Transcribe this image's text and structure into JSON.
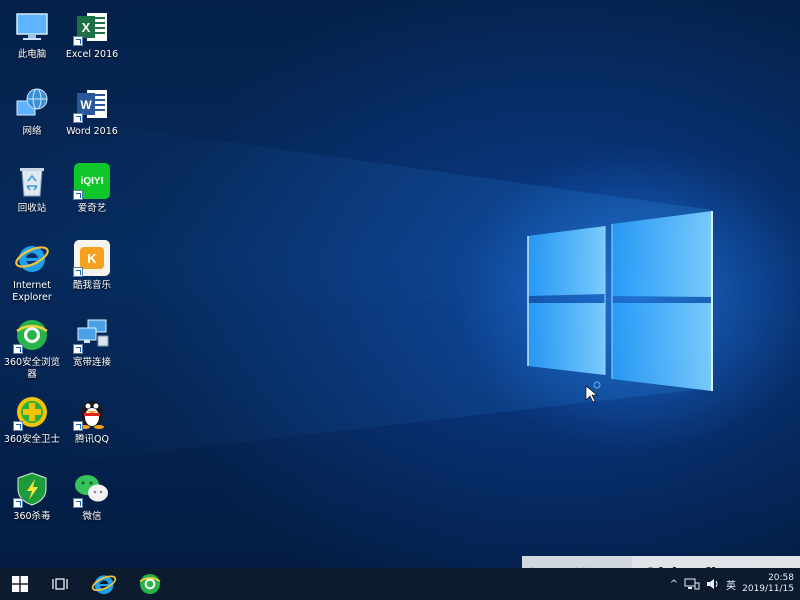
{
  "desktop": {
    "icons": [
      {
        "label": "此电脑"
      },
      {
        "label": "Excel 2016"
      },
      {
        "label": "网络"
      },
      {
        "label": "Word 2016"
      },
      {
        "label": "回收站"
      },
      {
        "label": "爱奇艺",
        "badge": "iQIYI"
      },
      {
        "label": "Internet Explorer"
      },
      {
        "label": "酷我音乐",
        "badge": "K"
      },
      {
        "label": "360安全浏览器"
      },
      {
        "label": "宽带连接"
      },
      {
        "label": "360安全卫士"
      },
      {
        "label": "腾讯QQ"
      },
      {
        "label": "360杀毒"
      },
      {
        "label": "微信"
      }
    ]
  },
  "taskbar": {
    "start_icon": "windows-logo",
    "task_view_icon": "task-view",
    "pinned": [
      {
        "name": "Internet Explorer",
        "icon": "ie-icon"
      },
      {
        "name": "360安全浏览器",
        "icon": "360-browser-icon"
      }
    ],
    "tray": {
      "chevron": "^",
      "ime": "英",
      "time": "20:58",
      "date": "2019/11/15"
    }
  },
  "watermark": {
    "left_text": "迅维网",
    "right_text": "Chinafix.com"
  },
  "colors": {
    "desktop_bg": "#062a5c",
    "taskbar_bg": "#0d1b2e",
    "accent_blue": "#1e90ff"
  }
}
